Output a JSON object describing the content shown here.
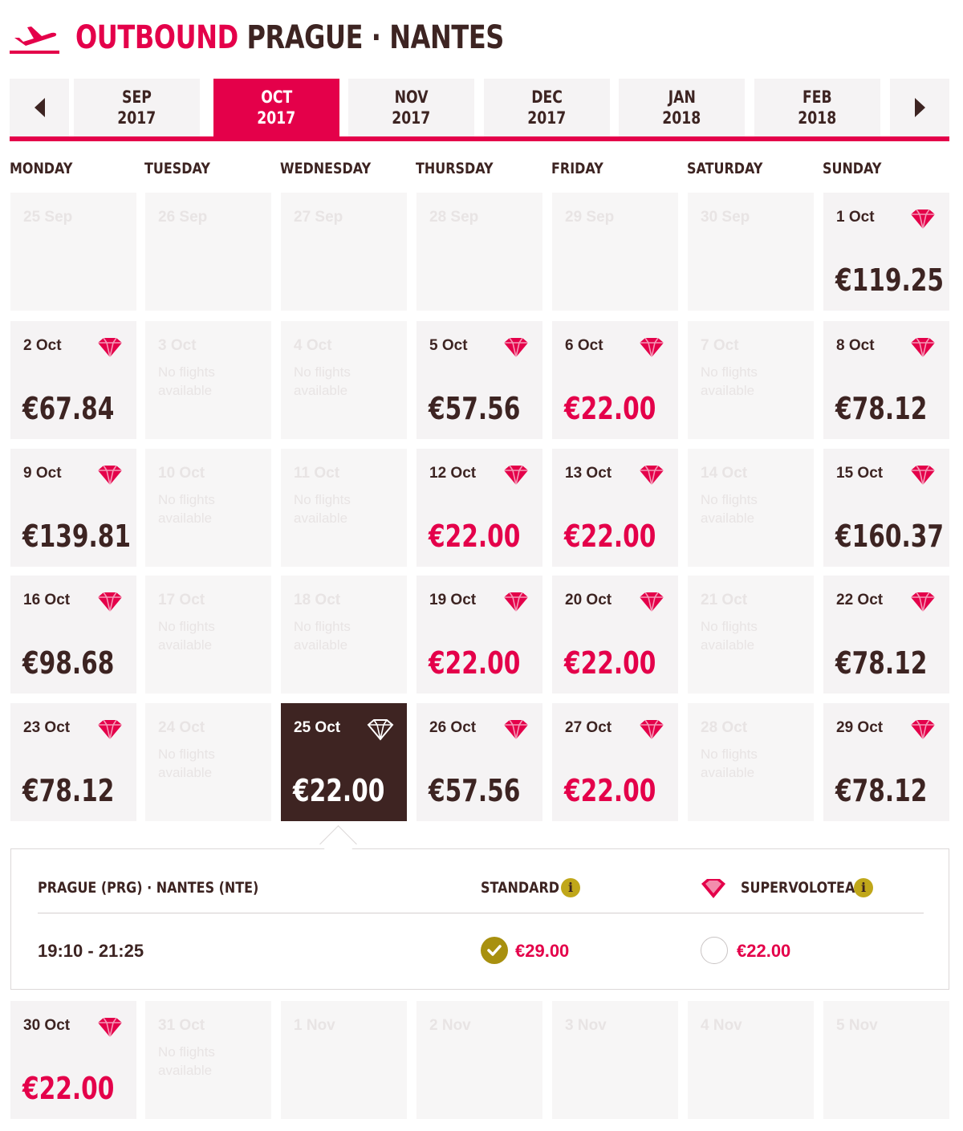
{
  "header": {
    "direction_label": "OUTBOUND",
    "route_label": "PRAGUE · NANTES",
    "icon": "plane-takeoff-icon"
  },
  "month_nav": {
    "prev_icon": "chevron-left-icon",
    "next_icon": "chevron-right-icon",
    "months": [
      {
        "month": "SEP",
        "year": "2017",
        "active": false
      },
      {
        "month": "OCT",
        "year": "2017",
        "active": true
      },
      {
        "month": "NOV",
        "year": "2017",
        "active": false
      },
      {
        "month": "DEC",
        "year": "2017",
        "active": false
      },
      {
        "month": "JAN",
        "year": "2018",
        "active": false
      },
      {
        "month": "FEB",
        "year": "2018",
        "active": false
      }
    ]
  },
  "weekdays": [
    "MONDAY",
    "TUESDAY",
    "WEDNESDAY",
    "THURSDAY",
    "FRIDAY",
    "SATURDAY",
    "SUNDAY"
  ],
  "calendar": {
    "no_flights_text": "No flights available",
    "weeks": [
      [
        {
          "date": "25 Sep",
          "state": "outside"
        },
        {
          "date": "26 Sep",
          "state": "outside"
        },
        {
          "date": "27 Sep",
          "state": "outside"
        },
        {
          "date": "28 Sep",
          "state": "outside"
        },
        {
          "date": "29 Sep",
          "state": "outside"
        },
        {
          "date": "30 Sep",
          "state": "outside"
        },
        {
          "date": "1 Oct",
          "state": "available",
          "price": "€119.25",
          "low": false
        }
      ],
      [
        {
          "date": "2 Oct",
          "state": "available",
          "price": "€67.84",
          "low": false
        },
        {
          "date": "3 Oct",
          "state": "none"
        },
        {
          "date": "4 Oct",
          "state": "none"
        },
        {
          "date": "5 Oct",
          "state": "available",
          "price": "€57.56",
          "low": false
        },
        {
          "date": "6 Oct",
          "state": "available",
          "price": "€22.00",
          "low": true
        },
        {
          "date": "7 Oct",
          "state": "none"
        },
        {
          "date": "8 Oct",
          "state": "available",
          "price": "€78.12",
          "low": false
        }
      ],
      [
        {
          "date": "9 Oct",
          "state": "available",
          "price": "€139.81",
          "low": false
        },
        {
          "date": "10 Oct",
          "state": "none"
        },
        {
          "date": "11 Oct",
          "state": "none"
        },
        {
          "date": "12 Oct",
          "state": "available",
          "price": "€22.00",
          "low": true
        },
        {
          "date": "13 Oct",
          "state": "available",
          "price": "€22.00",
          "low": true
        },
        {
          "date": "14 Oct",
          "state": "none"
        },
        {
          "date": "15 Oct",
          "state": "available",
          "price": "€160.37",
          "low": false
        }
      ],
      [
        {
          "date": "16 Oct",
          "state": "available",
          "price": "€98.68",
          "low": false
        },
        {
          "date": "17 Oct",
          "state": "none"
        },
        {
          "date": "18 Oct",
          "state": "none"
        },
        {
          "date": "19 Oct",
          "state": "available",
          "price": "€22.00",
          "low": true
        },
        {
          "date": "20 Oct",
          "state": "available",
          "price": "€22.00",
          "low": true
        },
        {
          "date": "21 Oct",
          "state": "none"
        },
        {
          "date": "22 Oct",
          "state": "available",
          "price": "€78.12",
          "low": false
        }
      ],
      [
        {
          "date": "23 Oct",
          "state": "available",
          "price": "€78.12",
          "low": false
        },
        {
          "date": "24 Oct",
          "state": "none"
        },
        {
          "date": "25 Oct",
          "state": "selected",
          "price": "€22.00",
          "low": true
        },
        {
          "date": "26 Oct",
          "state": "available",
          "price": "€57.56",
          "low": false
        },
        {
          "date": "27 Oct",
          "state": "available",
          "price": "€22.00",
          "low": true
        },
        {
          "date": "28 Oct",
          "state": "none"
        },
        {
          "date": "29 Oct",
          "state": "available",
          "price": "€78.12",
          "low": false
        }
      ],
      [
        {
          "date": "30 Oct",
          "state": "available",
          "price": "€22.00",
          "low": true
        },
        {
          "date": "31 Oct",
          "state": "none"
        },
        {
          "date": "1 Nov",
          "state": "outside"
        },
        {
          "date": "2 Nov",
          "state": "outside"
        },
        {
          "date": "3 Nov",
          "state": "outside"
        },
        {
          "date": "4 Nov",
          "state": "outside"
        },
        {
          "date": "5 Nov",
          "state": "outside"
        }
      ]
    ]
  },
  "flight_detail": {
    "route": "PRAGUE (PRG) · NANTES (NTE)",
    "standard_label": "STANDARD",
    "supervolotea_label": "SUPERVOLOTEA",
    "times": "19:10 - 21:25",
    "standard_price": "€29.00",
    "supervolotea_price": "€22.00",
    "standard_selected": true,
    "supervolotea_selected": false,
    "info_icon": "info-icon",
    "fare_icon": "diamond-gem-icon"
  },
  "colors": {
    "brand_red": "#e4004a",
    "dark_brown": "#3e2422",
    "cell_bg": "#f5f3f4",
    "gold": "#a8900f"
  }
}
